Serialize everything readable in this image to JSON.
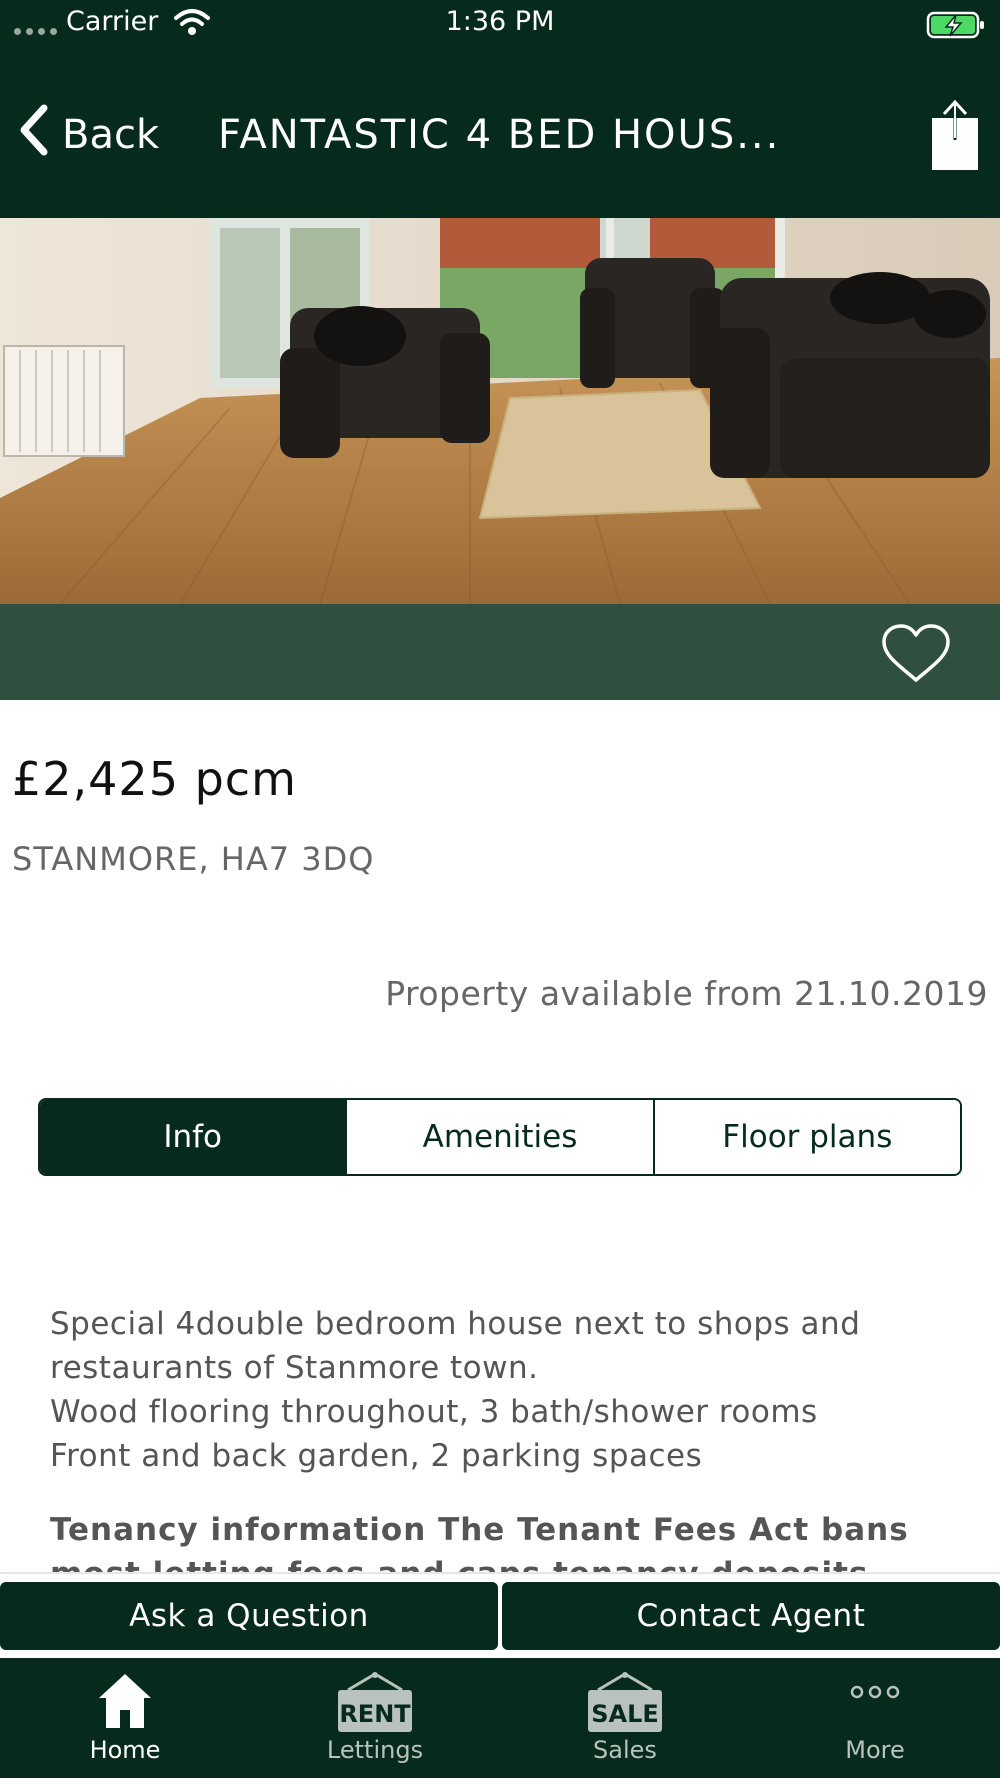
{
  "status_bar": {
    "carrier": "Carrier",
    "time": "1:36 PM"
  },
  "nav": {
    "back_label": "Back",
    "title": "FANTASTIC 4 BED HOUS..."
  },
  "listing": {
    "price": "£2,425 pcm",
    "address": "STANMORE, HA7 3DQ",
    "availability": "Property available from 21.10.2019",
    "favorited": false
  },
  "tabs": [
    {
      "label": "Info",
      "active": true
    },
    {
      "label": "Amenities",
      "active": false
    },
    {
      "label": "Floor plans",
      "active": false
    }
  ],
  "description": {
    "lines": [
      "Special 4double bedroom house next to shops and restaurants of Stanmore town.",
      "Wood flooring throughout, 3 bath/shower rooms",
      "Front and back garden, 2 parking spaces"
    ],
    "tenancy": "Tenancy information The Tenant Fees Act bans most letting fees and caps tenancy deposits"
  },
  "actions": {
    "ask": "Ask a Question",
    "contact": "Contact Agent"
  },
  "tabbar": [
    {
      "label": "Home",
      "icon": "home-icon",
      "active": true
    },
    {
      "label": "Lettings",
      "icon": "rent-sign-icon",
      "badge": "RENT",
      "active": false
    },
    {
      "label": "Sales",
      "icon": "sale-sign-icon",
      "badge": "SALE",
      "active": false
    },
    {
      "label": "More",
      "icon": "more-dots-icon",
      "active": false
    }
  ],
  "colors": {
    "brand_dark_green": "#062b1d",
    "photo_bar_green": "#2f4f3f",
    "muted_text": "#666666"
  }
}
